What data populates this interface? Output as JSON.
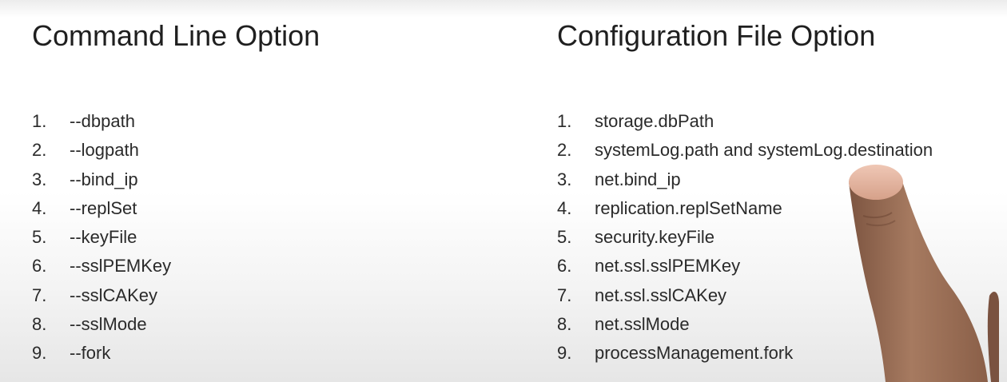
{
  "command_line": {
    "title": "Command Line Option",
    "items": [
      {
        "num": "1.",
        "text": "--dbpath"
      },
      {
        "num": "2.",
        "text": "--logpath"
      },
      {
        "num": "3.",
        "text": "--bind_ip"
      },
      {
        "num": "4.",
        "text": "--replSet"
      },
      {
        "num": "5.",
        "text": "--keyFile"
      },
      {
        "num": "6.",
        "text": "--sslPEMKey"
      },
      {
        "num": "7.",
        "text": "--sslCAKey"
      },
      {
        "num": "8.",
        "text": "--sslMode"
      },
      {
        "num": "9.",
        "text": "--fork"
      }
    ]
  },
  "config_file": {
    "title": "Configuration File Option",
    "items": [
      {
        "num": "1.",
        "text": "storage.dbPath"
      },
      {
        "num": "2.",
        "text": "systemLog.path and systemLog.destination"
      },
      {
        "num": "3.",
        "text": "net.bind_ip"
      },
      {
        "num": "4.",
        "text": "replication.replSetName"
      },
      {
        "num": "5.",
        "text": "security.keyFile"
      },
      {
        "num": "6.",
        "text": "net.ssl.sslPEMKey"
      },
      {
        "num": "7.",
        "text": "net.ssl.sslCAKey"
      },
      {
        "num": "8.",
        "text": "net.sslMode"
      },
      {
        "num": "9.",
        "text": "processManagement.fork"
      }
    ]
  },
  "colors": {
    "text": "#262626",
    "skin": "#a0745a",
    "nail": "#e2b6a3"
  }
}
